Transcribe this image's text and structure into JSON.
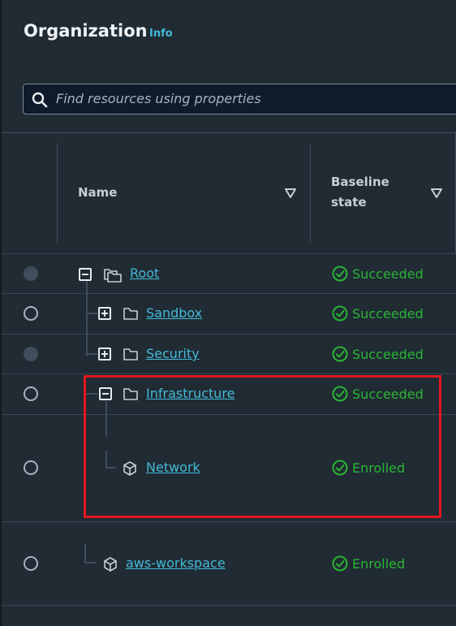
{
  "page": {
    "title": "Organization",
    "info_label": "Info"
  },
  "search": {
    "placeholder": "Find resources using properties",
    "icon": "search-icon"
  },
  "table": {
    "columns": [
      {
        "label": "Name",
        "sortable": true
      },
      {
        "label": "Baseline\nstate",
        "sortable": true
      }
    ],
    "rows": [
      {
        "name": "Root",
        "type": "organization",
        "expand": "collapse",
        "status": "Succeeded",
        "selectable": false
      },
      {
        "name": "Sandbox",
        "type": "ou",
        "expand": "expand",
        "status": "Succeeded",
        "selectable": true
      },
      {
        "name": "Security",
        "type": "ou",
        "expand": "expand",
        "status": "Succeeded",
        "selectable": false
      },
      {
        "name": "Infrastructure",
        "type": "ou",
        "expand": "collapse",
        "status": "Succeeded",
        "selectable": true
      },
      {
        "name": "Network",
        "type": "account",
        "expand": null,
        "status": "Enrolled",
        "selectable": true
      },
      {
        "name": "aws-workspace",
        "type": "account",
        "expand": null,
        "status": "Enrolled",
        "selectable": true
      }
    ]
  },
  "colors": {
    "link": "#44b9d6",
    "success": "#2bb534",
    "highlight": "#e3161e"
  }
}
